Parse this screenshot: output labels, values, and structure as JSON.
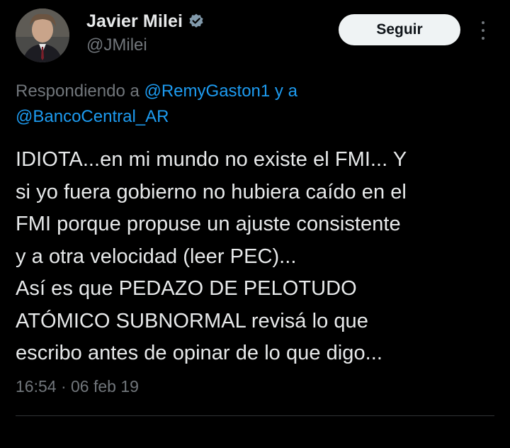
{
  "author": {
    "display_name": "Javier Milei",
    "handle": "@JMilei",
    "verified_icon": "verified-badge-icon",
    "follow_label": "Seguir",
    "more_icon": "more-options-icon"
  },
  "reply": {
    "prefix": "Respondiendo a",
    "mention_1": "@RemyGaston1",
    "connector": "y a",
    "mention_2": "@BancoCentral_AR"
  },
  "tweet": {
    "text": "IDIOTA...en mi mundo no existe el FMI... Y\nsi yo fuera gobierno no hubiera caído en el\nFMI porque propuse un ajuste consistente\ny a otra velocidad (leer PEC)...\nAsí es que PEDAZO DE PELOTUDO\nATÓMICO SUBNORMAL revisá lo que\nescribo antes de opinar de lo que digo...",
    "time": "16:54",
    "separator": "·",
    "date": "06 feb 19"
  },
  "colors": {
    "background": "#000000",
    "text": "#e7e9ea",
    "muted": "#71767b",
    "link": "#1d9bf0",
    "button_bg": "#eff3f4",
    "divider": "#2f3336"
  }
}
